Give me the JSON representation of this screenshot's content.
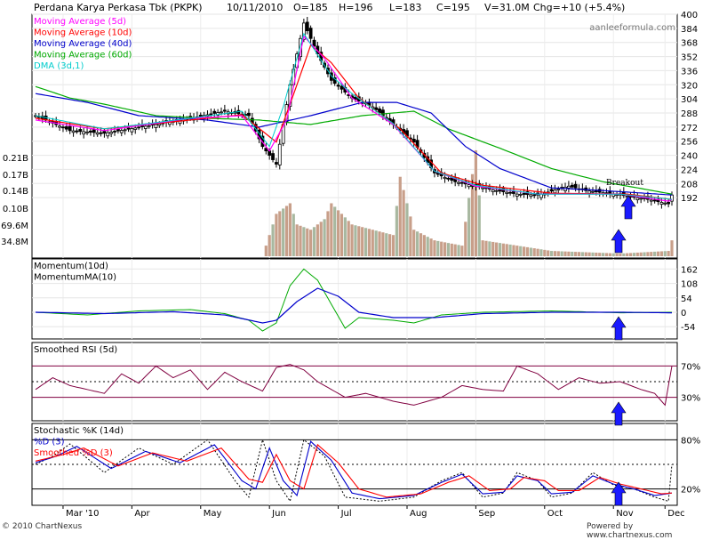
{
  "header": {
    "title": "Perdana Karya Perkasa Tbk (PKPK)",
    "date": "10/11/2010",
    "open": "O=185",
    "high": "H=196",
    "low": "L=183",
    "close": "C=195",
    "volume": "V=31.0M",
    "change": "Chg=+10 (+5.4%)"
  },
  "watermark": "aanleeformula.com",
  "annotation": "Breakout",
  "footer": {
    "left": "© 2010 ChartNexus",
    "right": "Powered by www.chartnexus.com"
  },
  "colors": {
    "ma5": "#ff00ff",
    "ma10": "#ff0000",
    "ma40": "#0000cc",
    "ma60": "#00aa00",
    "dma": "#00cccc",
    "rsi": "#800040",
    "momentum": "#00aa00",
    "momentum_ma": "#0000cc",
    "arrow": "#1a1aff",
    "volume_down": "#c89f8a",
    "volume_up": "#a8b8a0"
  },
  "chart_data": [
    {
      "panel": "price",
      "type": "candlestick",
      "legend": [
        {
          "label": "Moving Average (5d)",
          "color": "#ff00ff"
        },
        {
          "label": "Moving Average (10d)",
          "color": "#ff0000"
        },
        {
          "label": "Moving Average (40d)",
          "color": "#0000cc"
        },
        {
          "label": "Moving Average (60d)",
          "color": "#00aa00"
        },
        {
          "label": "DMA (3d,1)",
          "color": "#00cccc"
        }
      ],
      "y_ticks": [
        400,
        384,
        368,
        352,
        336,
        320,
        304,
        288,
        272,
        256,
        240,
        224,
        208,
        192
      ],
      "ylim": [
        176,
        400
      ],
      "volume_ticks": [
        "0.21B",
        "0.17B",
        "0.14B",
        "0.10B",
        "69.6M",
        "34.8M"
      ],
      "volume_lim": [
        0,
        0.21
      ],
      "x_labels": [
        "Mar '10",
        "Apr",
        "May",
        "Jun",
        "Jul",
        "Aug",
        "Sep",
        "Oct",
        "Nov",
        "Dec"
      ],
      "close_anchors": [
        [
          0,
          285
        ],
        [
          10,
          268
        ],
        [
          20,
          265
        ],
        [
          35,
          275
        ],
        [
          45,
          282
        ],
        [
          55,
          290
        ],
        [
          62,
          285
        ],
        [
          66,
          250
        ],
        [
          70,
          230
        ],
        [
          74,
          320
        ],
        [
          78,
          390
        ],
        [
          82,
          355
        ],
        [
          86,
          325
        ],
        [
          92,
          305
        ],
        [
          98,
          295
        ],
        [
          104,
          275
        ],
        [
          110,
          255
        ],
        [
          116,
          220
        ],
        [
          122,
          210
        ],
        [
          128,
          205
        ],
        [
          134,
          200
        ],
        [
          140,
          196
        ],
        [
          146,
          195
        ],
        [
          155,
          205
        ],
        [
          160,
          200
        ],
        [
          170,
          195
        ],
        [
          178,
          190
        ],
        [
          184,
          185
        ],
        [
          185,
          195
        ]
      ],
      "ma5_anchors": [
        [
          0,
          280
        ],
        [
          20,
          268
        ],
        [
          45,
          282
        ],
        [
          60,
          285
        ],
        [
          68,
          245
        ],
        [
          73,
          280
        ],
        [
          78,
          375
        ],
        [
          84,
          350
        ],
        [
          92,
          305
        ],
        [
          104,
          275
        ],
        [
          116,
          222
        ],
        [
          128,
          205
        ],
        [
          146,
          196
        ],
        [
          170,
          196
        ],
        [
          184,
          188
        ],
        [
          185,
          190
        ]
      ],
      "ma10_anchors": [
        [
          0,
          282
        ],
        [
          20,
          270
        ],
        [
          45,
          280
        ],
        [
          60,
          286
        ],
        [
          70,
          255
        ],
        [
          76,
          320
        ],
        [
          80,
          365
        ],
        [
          86,
          345
        ],
        [
          94,
          305
        ],
        [
          106,
          270
        ],
        [
          118,
          220
        ],
        [
          130,
          206
        ],
        [
          150,
          197
        ],
        [
          172,
          196
        ],
        [
          185,
          190
        ]
      ],
      "ma40_anchors": [
        [
          0,
          310
        ],
        [
          15,
          300
        ],
        [
          30,
          285
        ],
        [
          50,
          280
        ],
        [
          65,
          272
        ],
        [
          80,
          285
        ],
        [
          95,
          300
        ],
        [
          105,
          300
        ],
        [
          115,
          288
        ],
        [
          125,
          250
        ],
        [
          135,
          225
        ],
        [
          150,
          203
        ],
        [
          165,
          200
        ],
        [
          185,
          195
        ]
      ],
      "ma60_anchors": [
        [
          0,
          318
        ],
        [
          10,
          305
        ],
        [
          20,
          298
        ],
        [
          35,
          285
        ],
        [
          50,
          282
        ],
        [
          65,
          280
        ],
        [
          80,
          275
        ],
        [
          95,
          285
        ],
        [
          110,
          290
        ],
        [
          120,
          270
        ],
        [
          135,
          248
        ],
        [
          150,
          225
        ],
        [
          165,
          210
        ],
        [
          185,
          196
        ]
      ],
      "dma_anchors": [
        [
          0,
          285
        ],
        [
          20,
          270
        ],
        [
          45,
          282
        ],
        [
          60,
          290
        ],
        [
          68,
          250
        ],
        [
          72,
          295
        ],
        [
          78,
          378
        ],
        [
          86,
          330
        ],
        [
          92,
          310
        ],
        [
          104,
          276
        ],
        [
          116,
          222
        ],
        [
          128,
          206
        ],
        [
          146,
          196
        ],
        [
          170,
          196
        ],
        [
          185,
          190
        ]
      ],
      "volume_anchors": [
        [
          0,
          0
        ],
        [
          66,
          0
        ],
        [
          70,
          0.08
        ],
        [
          74,
          0.1
        ],
        [
          76,
          0.06
        ],
        [
          80,
          0.05
        ],
        [
          84,
          0.07
        ],
        [
          86,
          0.1
        ],
        [
          92,
          0.06
        ],
        [
          104,
          0.04
        ],
        [
          106,
          0.15
        ],
        [
          110,
          0.05
        ],
        [
          116,
          0.03
        ],
        [
          124,
          0.02
        ],
        [
          128,
          0.2
        ],
        [
          130,
          0.03
        ],
        [
          140,
          0.02
        ],
        [
          150,
          0.01
        ],
        [
          170,
          0.005
        ],
        [
          184,
          0.01
        ],
        [
          185,
          0.03
        ]
      ]
    },
    {
      "panel": "momentum",
      "type": "line",
      "legend": [
        {
          "label": "Momentum(10d)",
          "color": "#00aa00"
        },
        {
          "label": "MomentumMA(10)",
          "color": "#0000cc"
        }
      ],
      "y_ticks": [
        162,
        108,
        54,
        0,
        -54
      ],
      "ylim": [
        -100,
        200
      ],
      "momentum_anchors": [
        [
          0,
          0
        ],
        [
          15,
          -10
        ],
        [
          30,
          5
        ],
        [
          45,
          10
        ],
        [
          55,
          -5
        ],
        [
          62,
          -30
        ],
        [
          66,
          -70
        ],
        [
          70,
          -40
        ],
        [
          74,
          100
        ],
        [
          78,
          162
        ],
        [
          82,
          120
        ],
        [
          86,
          30
        ],
        [
          90,
          -60
        ],
        [
          94,
          -20
        ],
        [
          104,
          -30
        ],
        [
          110,
          -40
        ],
        [
          118,
          -10
        ],
        [
          130,
          0
        ],
        [
          150,
          5
        ],
        [
          170,
          -2
        ],
        [
          185,
          0
        ]
      ],
      "momentum_ma_anchors": [
        [
          0,
          0
        ],
        [
          20,
          -5
        ],
        [
          40,
          2
        ],
        [
          55,
          -10
        ],
        [
          66,
          -40
        ],
        [
          70,
          -30
        ],
        [
          76,
          40
        ],
        [
          82,
          90
        ],
        [
          88,
          60
        ],
        [
          94,
          0
        ],
        [
          104,
          -20
        ],
        [
          116,
          -20
        ],
        [
          130,
          -5
        ],
        [
          150,
          0
        ],
        [
          170,
          0
        ],
        [
          185,
          -2
        ]
      ]
    },
    {
      "panel": "rsi",
      "type": "line",
      "legend": [
        {
          "label": "Smoothed RSI (5d)",
          "color": "#800040"
        }
      ],
      "y_ticks": [
        "70%",
        "30%"
      ],
      "ylim": [
        0,
        100
      ],
      "rsi_anchors": [
        [
          0,
          40
        ],
        [
          5,
          55
        ],
        [
          10,
          45
        ],
        [
          20,
          35
        ],
        [
          25,
          60
        ],
        [
          30,
          48
        ],
        [
          35,
          70
        ],
        [
          40,
          55
        ],
        [
          45,
          65
        ],
        [
          50,
          40
        ],
        [
          55,
          62
        ],
        [
          60,
          50
        ],
        [
          66,
          38
        ],
        [
          70,
          68
        ],
        [
          74,
          72
        ],
        [
          78,
          65
        ],
        [
          82,
          50
        ],
        [
          86,
          40
        ],
        [
          90,
          30
        ],
        [
          96,
          35
        ],
        [
          104,
          25
        ],
        [
          110,
          20
        ],
        [
          118,
          30
        ],
        [
          124,
          45
        ],
        [
          130,
          40
        ],
        [
          136,
          38
        ],
        [
          140,
          70
        ],
        [
          146,
          60
        ],
        [
          152,
          40
        ],
        [
          158,
          55
        ],
        [
          164,
          48
        ],
        [
          170,
          50
        ],
        [
          176,
          40
        ],
        [
          180,
          35
        ],
        [
          183,
          20
        ],
        [
          185,
          70
        ]
      ]
    },
    {
      "panel": "stochastic",
      "type": "line",
      "legend": [
        {
          "label": "Stochastic %K (14d)",
          "color": "#000000"
        },
        {
          "label": "%D (3)",
          "color": "#0000cc"
        },
        {
          "label": "Smoothed %D (3)",
          "color": "#ff0000"
        }
      ],
      "y_ticks": [
        "80%",
        "20%"
      ],
      "ylim": [
        0,
        100
      ],
      "k_anchors": [
        [
          0,
          50
        ],
        [
          5,
          60
        ],
        [
          10,
          75
        ],
        [
          20,
          40
        ],
        [
          30,
          70
        ],
        [
          40,
          50
        ],
        [
          50,
          80
        ],
        [
          58,
          30
        ],
        [
          62,
          10
        ],
        [
          66,
          80
        ],
        [
          70,
          30
        ],
        [
          74,
          5
        ],
        [
          78,
          80
        ],
        [
          84,
          60
        ],
        [
          90,
          10
        ],
        [
          100,
          5
        ],
        [
          110,
          10
        ],
        [
          118,
          30
        ],
        [
          124,
          40
        ],
        [
          130,
          10
        ],
        [
          136,
          15
        ],
        [
          140,
          40
        ],
        [
          146,
          30
        ],
        [
          150,
          10
        ],
        [
          156,
          15
        ],
        [
          162,
          40
        ],
        [
          168,
          25
        ],
        [
          174,
          20
        ],
        [
          180,
          10
        ],
        [
          184,
          5
        ],
        [
          185,
          50
        ]
      ],
      "d_anchors": [
        [
          0,
          52
        ],
        [
          6,
          60
        ],
        [
          12,
          72
        ],
        [
          22,
          45
        ],
        [
          32,
          66
        ],
        [
          42,
          52
        ],
        [
          52,
          74
        ],
        [
          60,
          30
        ],
        [
          64,
          20
        ],
        [
          68,
          70
        ],
        [
          72,
          30
        ],
        [
          76,
          12
        ],
        [
          80,
          78
        ],
        [
          86,
          55
        ],
        [
          92,
          15
        ],
        [
          100,
          8
        ],
        [
          110,
          12
        ],
        [
          118,
          28
        ],
        [
          124,
          38
        ],
        [
          130,
          14
        ],
        [
          136,
          16
        ],
        [
          140,
          36
        ],
        [
          146,
          30
        ],
        [
          150,
          14
        ],
        [
          156,
          16
        ],
        [
          162,
          36
        ],
        [
          168,
          26
        ],
        [
          174,
          20
        ],
        [
          180,
          12
        ],
        [
          185,
          15
        ]
      ],
      "sd_anchors": [
        [
          0,
          54
        ],
        [
          8,
          62
        ],
        [
          14,
          70
        ],
        [
          24,
          48
        ],
        [
          34,
          64
        ],
        [
          44,
          54
        ],
        [
          54,
          70
        ],
        [
          62,
          32
        ],
        [
          66,
          28
        ],
        [
          70,
          62
        ],
        [
          74,
          30
        ],
        [
          78,
          20
        ],
        [
          82,
          74
        ],
        [
          88,
          52
        ],
        [
          94,
          20
        ],
        [
          102,
          10
        ],
        [
          112,
          14
        ],
        [
          120,
          28
        ],
        [
          126,
          36
        ],
        [
          132,
          18
        ],
        [
          138,
          20
        ],
        [
          142,
          34
        ],
        [
          148,
          30
        ],
        [
          152,
          18
        ],
        [
          158,
          18
        ],
        [
          164,
          34
        ],
        [
          170,
          26
        ],
        [
          176,
          20
        ],
        [
          182,
          14
        ],
        [
          185,
          15
        ]
      ]
    }
  ]
}
